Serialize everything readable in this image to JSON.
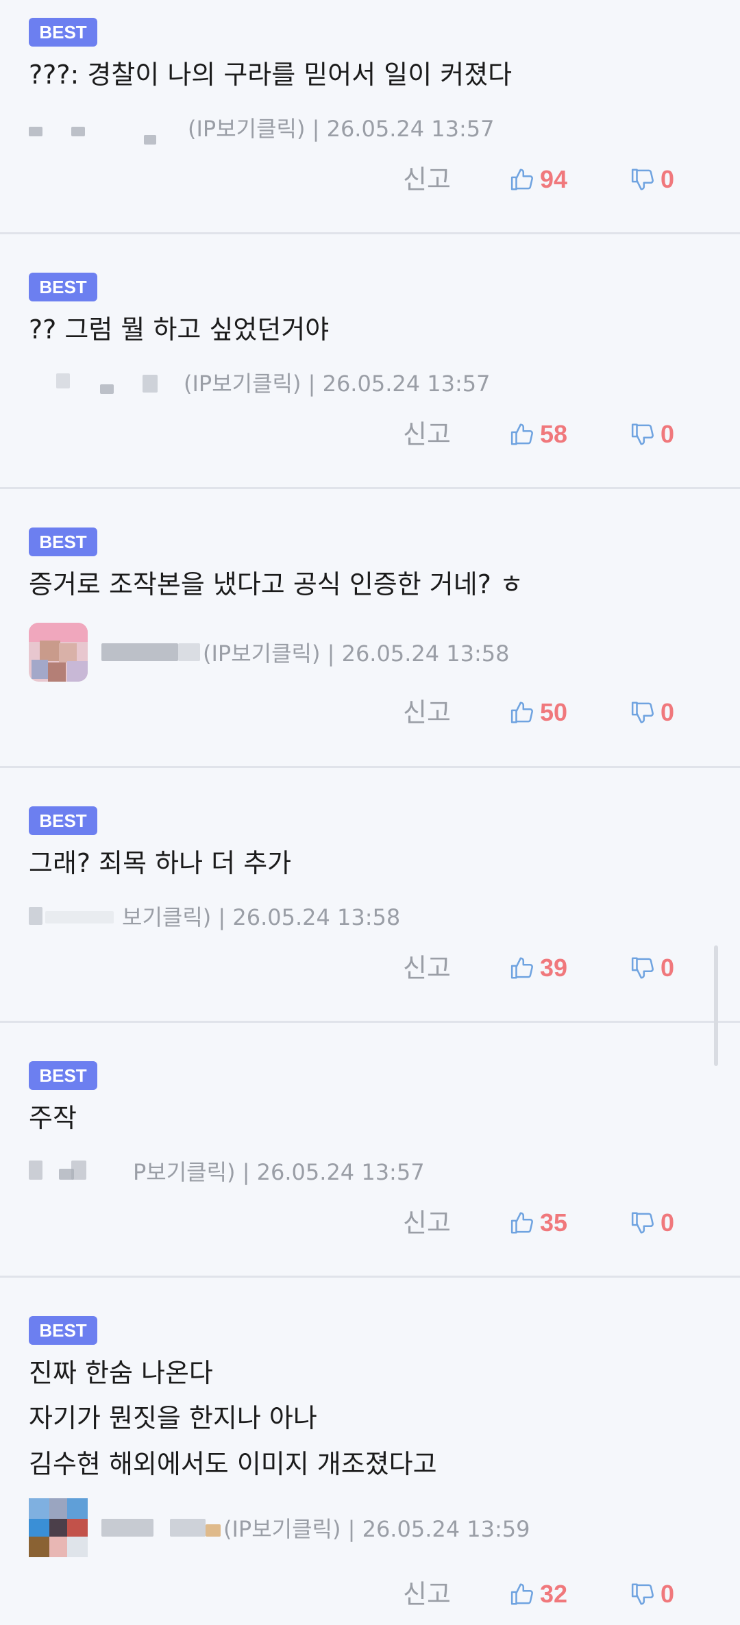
{
  "badge_label": "BEST",
  "report_label": "신고",
  "colors": {
    "badge": "#6c7ff0",
    "vote_count": "#f0787c",
    "icon": "#6fa3e0",
    "meta": "#9a9ea6",
    "background": "#f5f7fb"
  },
  "comments": [
    {
      "lines": [
        "???: 경찰이 나의 구라를 믿어서 일이 커졌다"
      ],
      "meta": "(IP보기클릭) | 26.05.24 13:57",
      "likes": "94",
      "dislikes": "0"
    },
    {
      "lines": [
        "?? 그럼 뭘 하고 싶었던거야"
      ],
      "meta": "(IP보기클릭) | 26.05.24 13:57",
      "likes": "58",
      "dislikes": "0"
    },
    {
      "lines": [
        "증거로 조작본을 냈다고 공식 인증한 거네? ㅎ"
      ],
      "meta": "(IP보기클릭) | 26.05.24 13:58",
      "likes": "50",
      "dislikes": "0"
    },
    {
      "lines": [
        "그래? 죄목 하나 더 추가"
      ],
      "meta": "보기클릭) | 26.05.24 13:58",
      "likes": "39",
      "dislikes": "0"
    },
    {
      "lines": [
        "주작"
      ],
      "meta": "P보기클릭) | 26.05.24 13:57",
      "likes": "35",
      "dislikes": "0"
    },
    {
      "lines": [
        "진짜 한숨 나온다",
        "자기가 뭔짓을 한지나 아나",
        "김수현 해외에서도 이미지 개조졌다고"
      ],
      "meta": "(IP보기클릭) | 26.05.24 13:59",
      "likes": "32",
      "dislikes": "0"
    }
  ]
}
